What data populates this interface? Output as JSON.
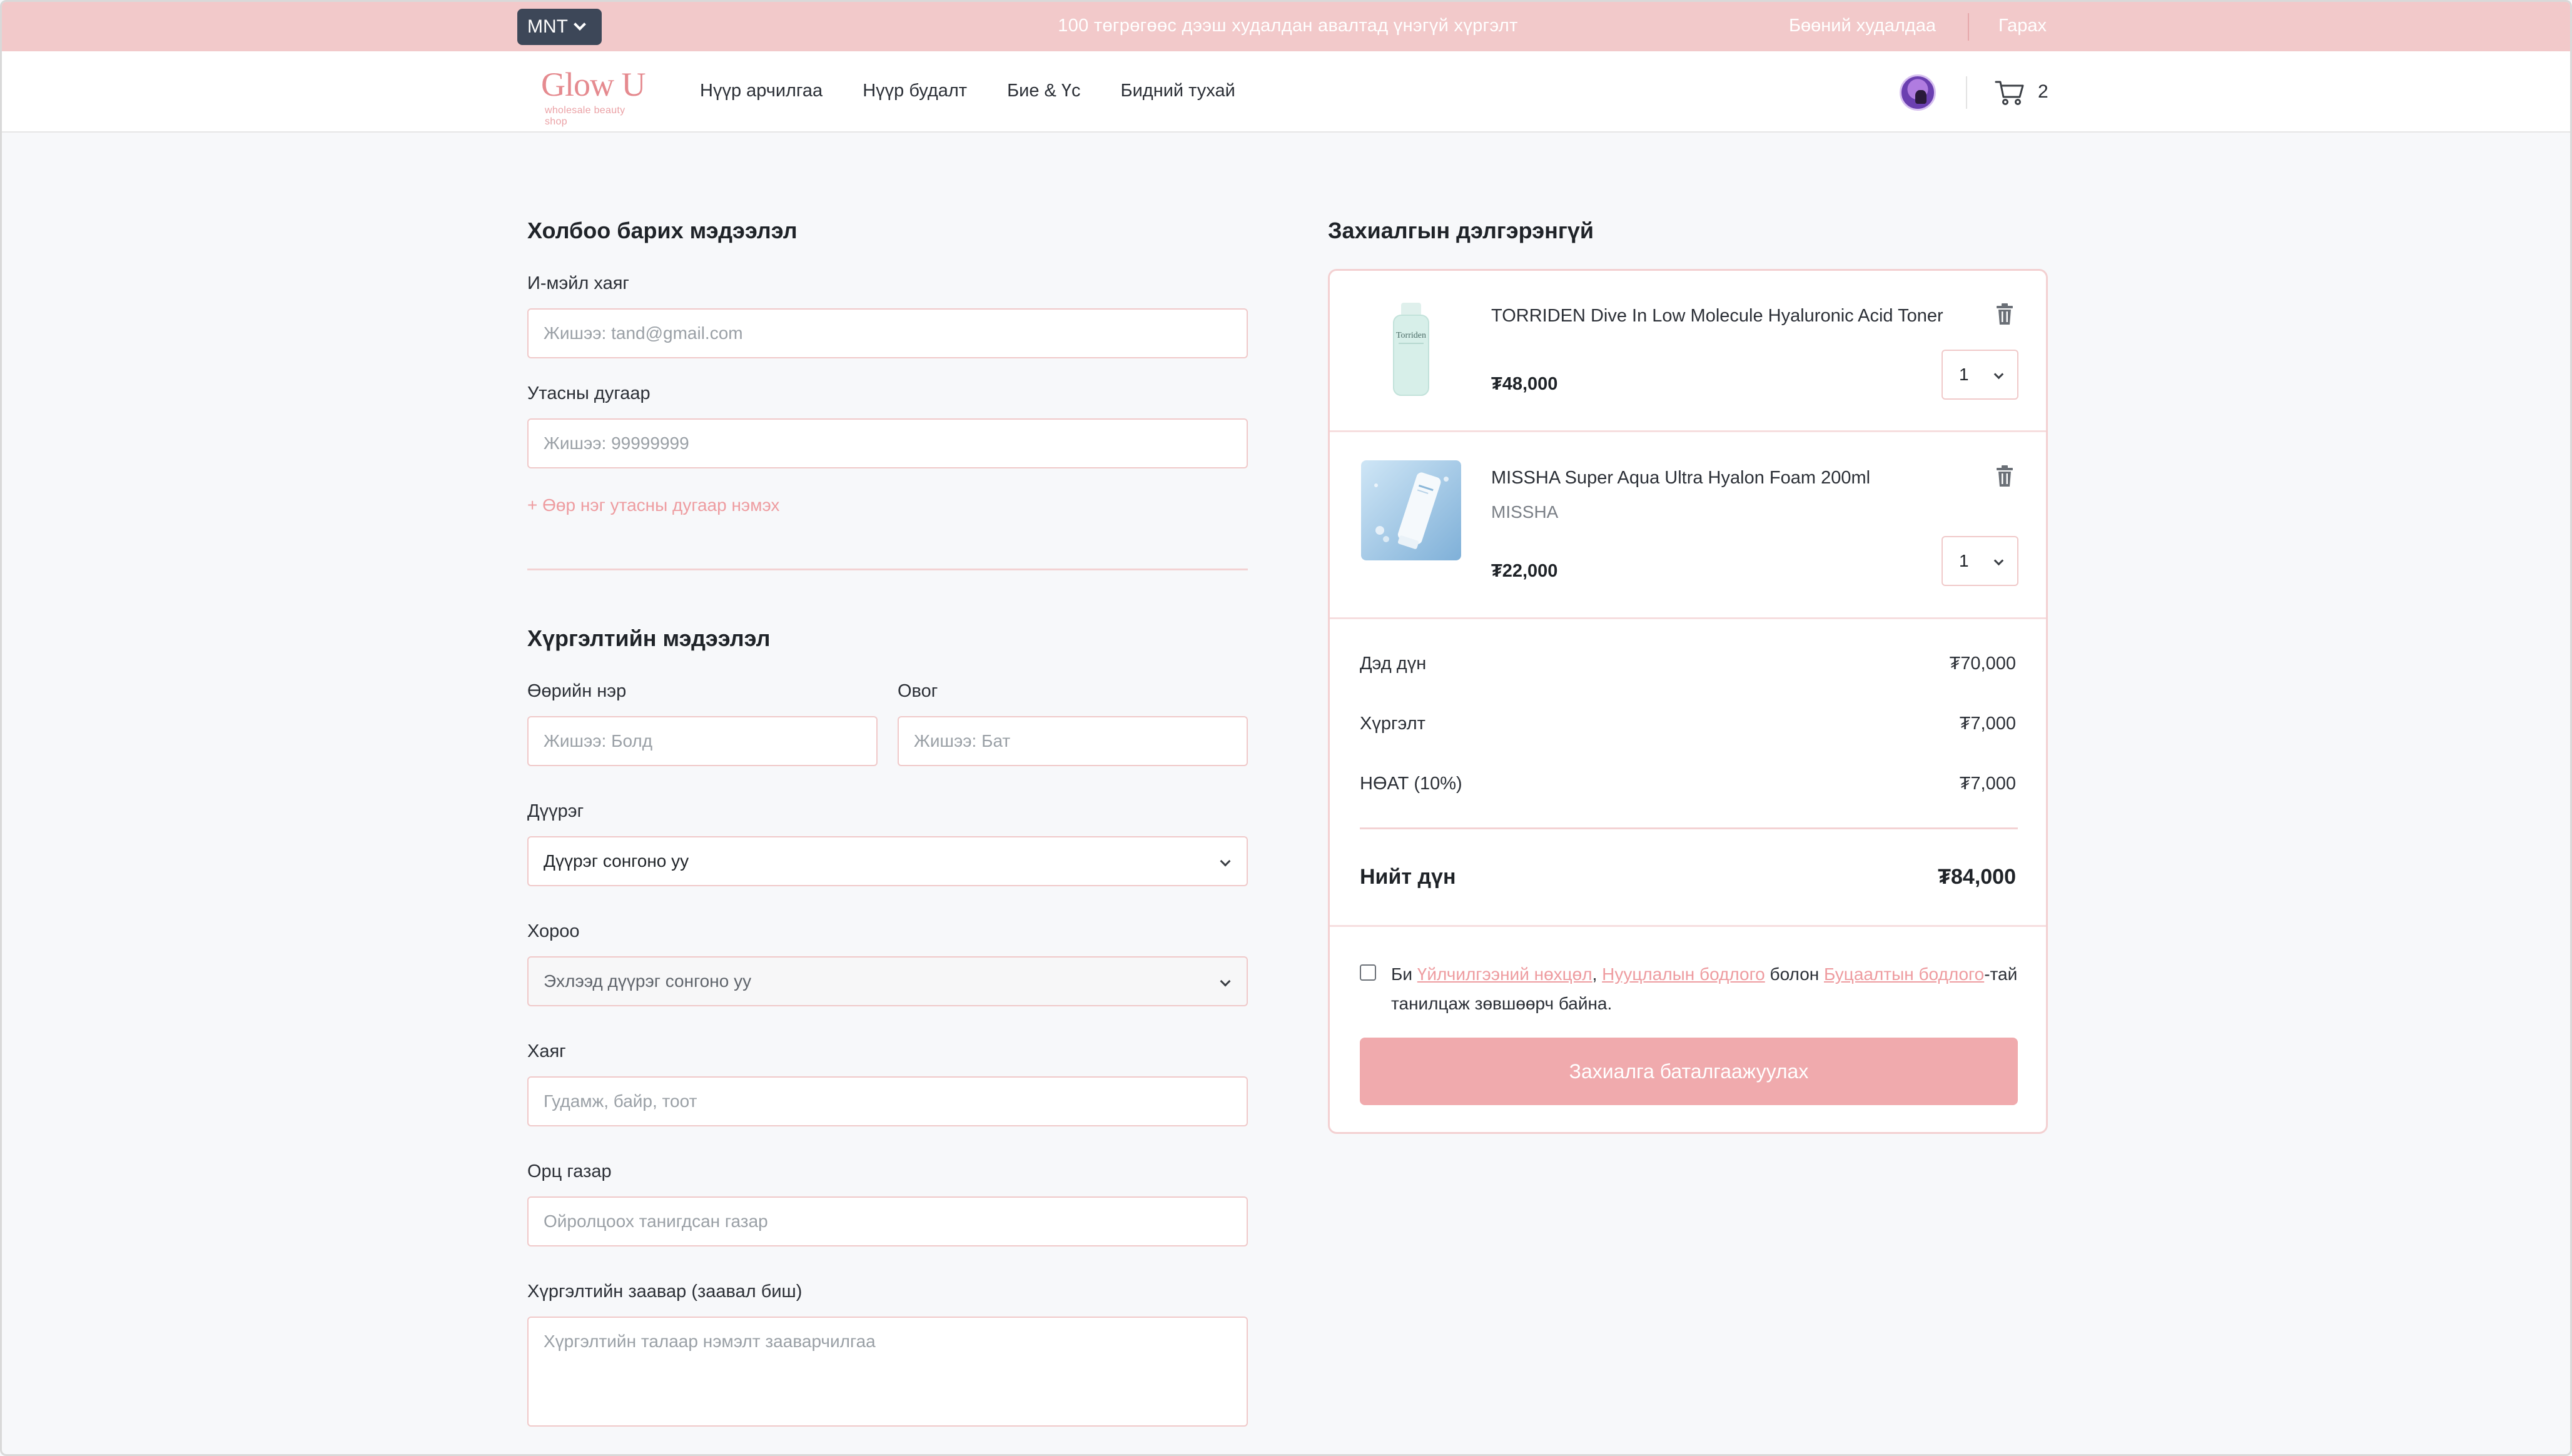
{
  "topbar": {
    "currency": "MNT",
    "announcement": "100 төгрөгөөс дээш худалдан авалтад үнэгүй хүргэлт",
    "links": [
      "Бөөний худалдаа",
      "Гарах"
    ]
  },
  "header": {
    "logo_text": "Glow U",
    "logo_sub": "wholesale beauty shop",
    "nav": [
      "Нүүр арчилгаа",
      "Нүүр будалт",
      "Бие & Үс",
      "Бидний тухай"
    ],
    "cart_count": "2"
  },
  "contact": {
    "title": "Холбоо барих мэдээлэл",
    "email_label": "И-мэйл хаяг",
    "email_placeholder": "Жишээ: tand@gmail.com",
    "phone_label": "Утасны дугаар",
    "phone_placeholder": "Жишээ: 99999999",
    "add_phone": "+ Өөр нэг утасны дугаар нэмэх"
  },
  "delivery": {
    "title": "Хүргэлтийн мэдээлэл",
    "first_name_label": "Өөрийн нэр",
    "first_name_placeholder": "Жишээ: Болд",
    "last_name_label": "Овог",
    "last_name_placeholder": "Жишээ: Бат",
    "district_label": "Дүүрэг",
    "district_value": "Дүүрэг сонгоно уу",
    "khoroo_label": "Хороо",
    "khoroo_value": "Эхлээд дүүрэг сонгоно уу",
    "address_label": "Хаяг",
    "address_placeholder": "Гудамж, байр, тоот",
    "landmark_label": "Орц газар",
    "landmark_placeholder": "Ойролцоох танигдсан газар",
    "instructions_label": "Хүргэлтийн заавар (заавал биш)",
    "instructions_placeholder": "Хүргэлтийн талаар нэмэлт зааварчилгаа"
  },
  "order": {
    "title": "Захиалгын дэлгэрэнгүй",
    "items": [
      {
        "name": "TORRIDEN Dive In Low Molecule Hyaluronic Acid Toner",
        "brand": "",
        "price": "₮48,000",
        "qty": "1",
        "thumb_label": "Torriden"
      },
      {
        "name": "MISSHA Super Aqua Ultra Hyalon Foam 200ml",
        "brand": "MISSHA",
        "price": "₮22,000",
        "qty": "1",
        "thumb_label": ""
      }
    ],
    "subtotal_label": "Дэд дүн",
    "subtotal": "₮70,000",
    "shipping_label": "Хүргэлт",
    "shipping": "₮7,000",
    "vat_label": "НӨАТ (10%)",
    "vat": "₮7,000",
    "total_label": "Нийт дүн",
    "total": "₮84,000",
    "agree_pre": "Би ",
    "terms_link": "Үйлчилгээний нөхцөл",
    "comma": ", ",
    "privacy_link": "Нууцлалын бодлого",
    "and": " болон ",
    "refund_link": "Буцаалтын бодлого",
    "agree_post": "-тай танилцаж зөвшөөрч байна.",
    "confirm_button": "Захиалга баталгаажуулах"
  },
  "colors": {
    "accent": "#f0aaad",
    "topbar": "#f2c9ca",
    "link": "#ee9ca0"
  }
}
